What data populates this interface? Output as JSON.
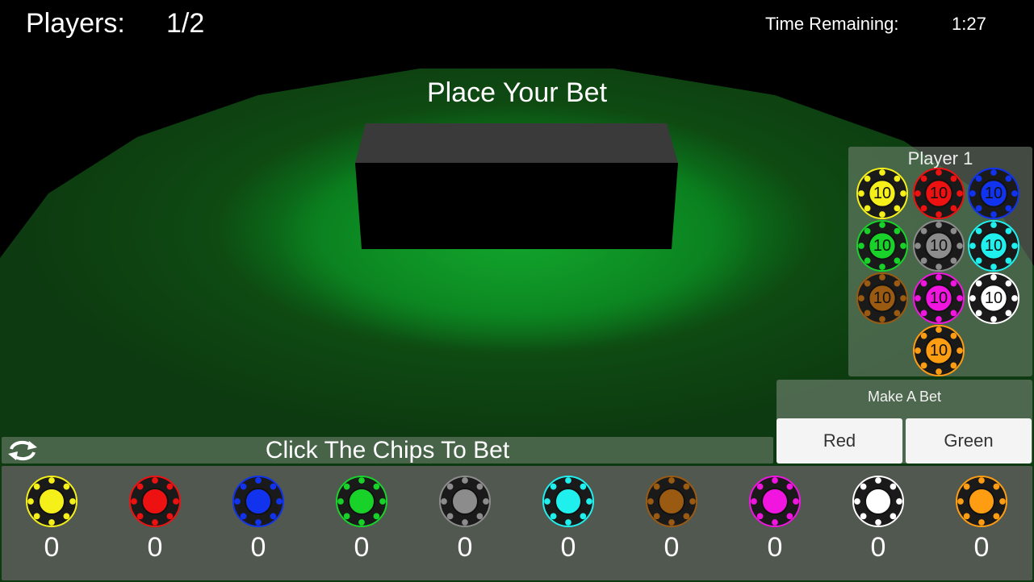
{
  "hud": {
    "players_label": "Players:",
    "players_value": "1/2",
    "time_label": "Time Remaining:",
    "time_value": "1:27"
  },
  "table": {
    "title": "Place Your Bet",
    "felt_color": "#0b7a1e"
  },
  "player_panel": {
    "title": "Player 1",
    "chip_value": "10",
    "chips": [
      {
        "color": "#f5f019",
        "name": "yellow"
      },
      {
        "color": "#ee1111",
        "name": "red"
      },
      {
        "color": "#1133ee",
        "name": "blue"
      },
      {
        "color": "#18d22a",
        "name": "green"
      },
      {
        "color": "#8c8c8c",
        "name": "gray"
      },
      {
        "color": "#1ff0ee",
        "name": "cyan"
      },
      {
        "color": "#9a5a12",
        "name": "brown"
      },
      {
        "color": "#f016e0",
        "name": "magenta"
      },
      {
        "color": "#ffffff",
        "name": "white"
      },
      {
        "color": "#ff9d12",
        "name": "orange"
      }
    ]
  },
  "bet_panel": {
    "title": "Make A Bet",
    "red_label": "Red",
    "green_label": "Green"
  },
  "hint": {
    "text": "Click The Chips To Bet",
    "refresh_icon": "refresh-icon"
  },
  "tray": {
    "slots": [
      {
        "color": "#f5f019",
        "count": "0"
      },
      {
        "color": "#ee1111",
        "count": "0"
      },
      {
        "color": "#1133ee",
        "count": "0"
      },
      {
        "color": "#18d22a",
        "count": "0"
      },
      {
        "color": "#8c8c8c",
        "count": "0"
      },
      {
        "color": "#1ff0ee",
        "count": "0"
      },
      {
        "color": "#9a5a12",
        "count": "0"
      },
      {
        "color": "#f016e0",
        "count": "0"
      },
      {
        "color": "#ffffff",
        "count": "0"
      },
      {
        "color": "#ff9d12",
        "count": "0"
      }
    ]
  }
}
